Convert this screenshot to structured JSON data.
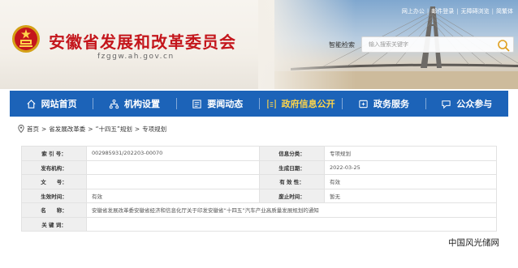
{
  "header": {
    "top_links": [
      "网上办公",
      "邮件登录",
      "无障碍浏览",
      "简繁体"
    ],
    "site_title": "安徽省发展和改革委员会",
    "site_domain": "fzggw.ah.gov.cn",
    "search_label": "智能检索",
    "search_placeholder": "输入搜索关键字"
  },
  "nav": {
    "items": [
      {
        "label": "网站首页",
        "icon": "home-icon"
      },
      {
        "label": "机构设置",
        "icon": "org-chart-icon"
      },
      {
        "label": "要闻动态",
        "icon": "news-icon"
      },
      {
        "label": "政府信息公开",
        "icon": "info-disclosure-icon",
        "active": true
      },
      {
        "label": "政务服务",
        "icon": "service-icon"
      },
      {
        "label": "公众参与",
        "icon": "participation-icon"
      }
    ],
    "colors": {
      "bar": "#1c63b8",
      "active_text": "#ffd54a"
    }
  },
  "breadcrumb": {
    "items": [
      "首页",
      "省发展改革委",
      "“十四五”规划",
      "专项规划"
    ],
    "separator": ">"
  },
  "info": {
    "index_label": "索 引 号：",
    "index_value": "002985931/202203-00070",
    "category_label": "信息分类：",
    "category_value": "专项规划",
    "publisher_label": "发布机构：",
    "publisher_value": "",
    "date_label": "生成日期：",
    "date_value": "2022-03-25",
    "doc_no_label": "文　　号：",
    "doc_no_value": "",
    "validity_label": "有 效 性：",
    "validity_value": "有效",
    "effective_label": "生效时间：",
    "effective_value": "有效",
    "abolish_label": "废止时间：",
    "abolish_value": "暂无",
    "name_label": "名　　称：",
    "name_value": "安徽省发展改革委安徽省经济和信息化厅关于印发安徽省“十四五”汽车产业高质量发展规划的通知",
    "keywords_label": "关 键 词：",
    "keywords_value": ""
  },
  "watermark": "中国风光储网"
}
